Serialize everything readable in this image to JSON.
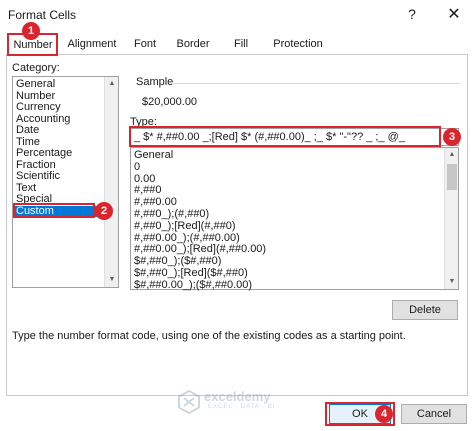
{
  "window": {
    "title": "Format Cells",
    "help": "?",
    "close": "✕"
  },
  "tabs": [
    {
      "label": "Number",
      "active": true
    },
    {
      "label": "Alignment"
    },
    {
      "label": "Font"
    },
    {
      "label": "Border"
    },
    {
      "label": "Fill"
    },
    {
      "label": "Protection"
    }
  ],
  "category": {
    "label": "Category:",
    "items": [
      "General",
      "Number",
      "Currency",
      "Accounting",
      "Date",
      "Time",
      "Percentage",
      "Fraction",
      "Scientific",
      "Text",
      "Special",
      "Custom"
    ],
    "selected": "Custom"
  },
  "sample": {
    "label": "Sample",
    "value": "$20,000.00"
  },
  "type": {
    "label": "Type:",
    "value": "_ $* #,##0.00 _;[Red] $* (#,##0.00)_ ;_ $* \"-\"?? _ ;_ @_",
    "list": [
      "General",
      "0",
      "0.00",
      "#,##0",
      "#,##0.00",
      "#,##0_);(#,##0)",
      "#,##0_);[Red](#,##0)",
      "#,##0.00_);(#,##0.00)",
      "#,##0.00_);[Red](#,##0.00)",
      "$#,##0_);($#,##0)",
      "$#,##0_);[Red]($#,##0)",
      "$#,##0.00_);($#,##0.00)"
    ]
  },
  "buttons": {
    "delete": "Delete",
    "ok": "OK",
    "cancel": "Cancel"
  },
  "description": "Type the number format code, using one of the existing codes as a starting point.",
  "annotations": [
    "1",
    "2",
    "3",
    "4"
  ],
  "watermark": {
    "name": "exceldemy",
    "tagline": "EXCEL · DATA · BI"
  },
  "colors": {
    "highlight": "#d9262e",
    "selection": "#0078d7"
  },
  "icons": [
    "help-icon",
    "close-icon",
    "scroll-up-arrow-icon",
    "scroll-down-arrow-icon",
    "exceldemy-logo-icon"
  ]
}
